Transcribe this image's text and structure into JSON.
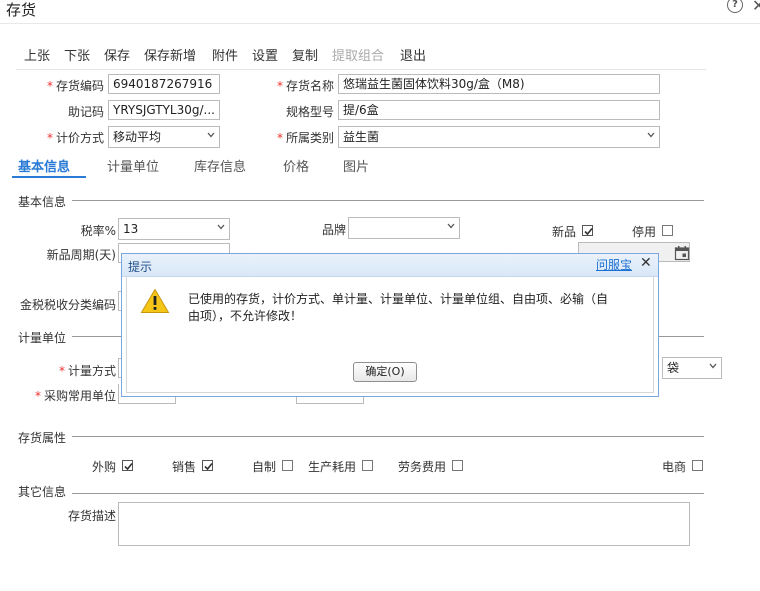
{
  "window": {
    "title": "存货",
    "help_icon": "help-circle-icon",
    "close_icon": "close-icon"
  },
  "toolbar": [
    "上张",
    "下张",
    "保存",
    "保存新增",
    "附件",
    "设置",
    "复制",
    "提取组合",
    "退出"
  ],
  "toolbar_disabled": [
    "提取组合"
  ],
  "form": {
    "code_label": "存货编码",
    "code_value": "6940187267916",
    "name_label": "存货名称",
    "name_value": "悠瑞益生菌固体饮料30g/盒（M8)",
    "mnemonic_label": "助记码",
    "mnemonic_value": "YRYSJGTYL30g/...",
    "spec_label": "规格型号",
    "spec_value": "提/6盒",
    "pricing_label": "计价方式",
    "pricing_value": "移动平均",
    "category_label": "所属类别",
    "category_value": "益生菌"
  },
  "tabs": [
    "基本信息",
    "计量单位",
    "库存信息",
    "价格",
    "图片"
  ],
  "basic": {
    "section_title": "基本信息",
    "tax_label": "税率%",
    "tax_value": "13",
    "brand_label": "品牌",
    "brand_value": "",
    "new_label": "新品",
    "new_checked": true,
    "disable_label": "停用",
    "disable_checked": false,
    "cycle_label": "新品周期(天)",
    "tax_code_label": "金税税收分类编码"
  },
  "unit": {
    "section_title": "计量单位",
    "method_label": "计量方式",
    "purchase_label": "采购常用单位",
    "unit_value": "袋"
  },
  "attrs": {
    "section_title": "存货属性",
    "items": [
      {
        "label": "外购",
        "checked": true
      },
      {
        "label": "销售",
        "checked": true
      },
      {
        "label": "自制",
        "checked": false
      },
      {
        "label": "生产耗用",
        "checked": false
      },
      {
        "label": "劳务费用",
        "checked": false
      },
      {
        "label": "电商",
        "checked": false
      }
    ]
  },
  "other": {
    "section_title": "其它信息",
    "desc_label": "存货描述",
    "desc_value": ""
  },
  "dialog": {
    "title": "提示",
    "help_link": "问服宝",
    "message": "已使用的存货，计价方式、单计量、计量单位、计量单位组、自由项、必输（自由项），不允许修改！",
    "ok_label": "确定(O)",
    "icon": "warning-icon"
  }
}
